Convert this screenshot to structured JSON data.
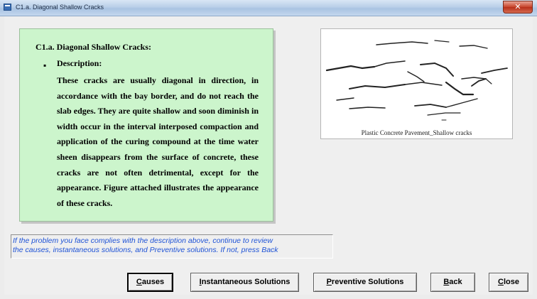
{
  "window": {
    "title": "C1.a. Diagonal Shallow Cracks"
  },
  "description": {
    "heading": "C1.a. Diagonal Shallow Cracks:",
    "bullet": "▪",
    "subheading": "Description:",
    "body": "These cracks are usually diagonal in direction, in accordance with the bay border, and do not reach the slab edges. They are quite shallow and soon diminish in width occur in the interval interposed compaction and application of the curing compound at the time water sheen disappears from the surface of concrete, these cracks are not often detrimental, except for the appearance. Figure attached illustrates the appearance of these cracks."
  },
  "figure": {
    "caption": "Plastic Concrete Pavement_Shallow cracks"
  },
  "info": {
    "line1": "If the problem you face complies with the description above, continue to review",
    "line2": "the causes, instantaneous solutions, and Preventive solutions. If not, press Back"
  },
  "buttons": {
    "causes_hotkey": "C",
    "causes_rest": "auses",
    "instant_hotkey": "I",
    "instant_rest": "nstantaneous Solutions",
    "preventive_hotkey": "P",
    "preventive_rest": "reventive Solutions",
    "back_hotkey": "B",
    "back_rest": "ack",
    "close_hotkey": "C",
    "close_rest": "lose"
  },
  "colors": {
    "panel_bg": "#ccf5cc",
    "info_text": "#1f53d6",
    "window_bg": "#efefef"
  },
  "icons": {
    "window": "app-icon",
    "close": "close-icon"
  }
}
